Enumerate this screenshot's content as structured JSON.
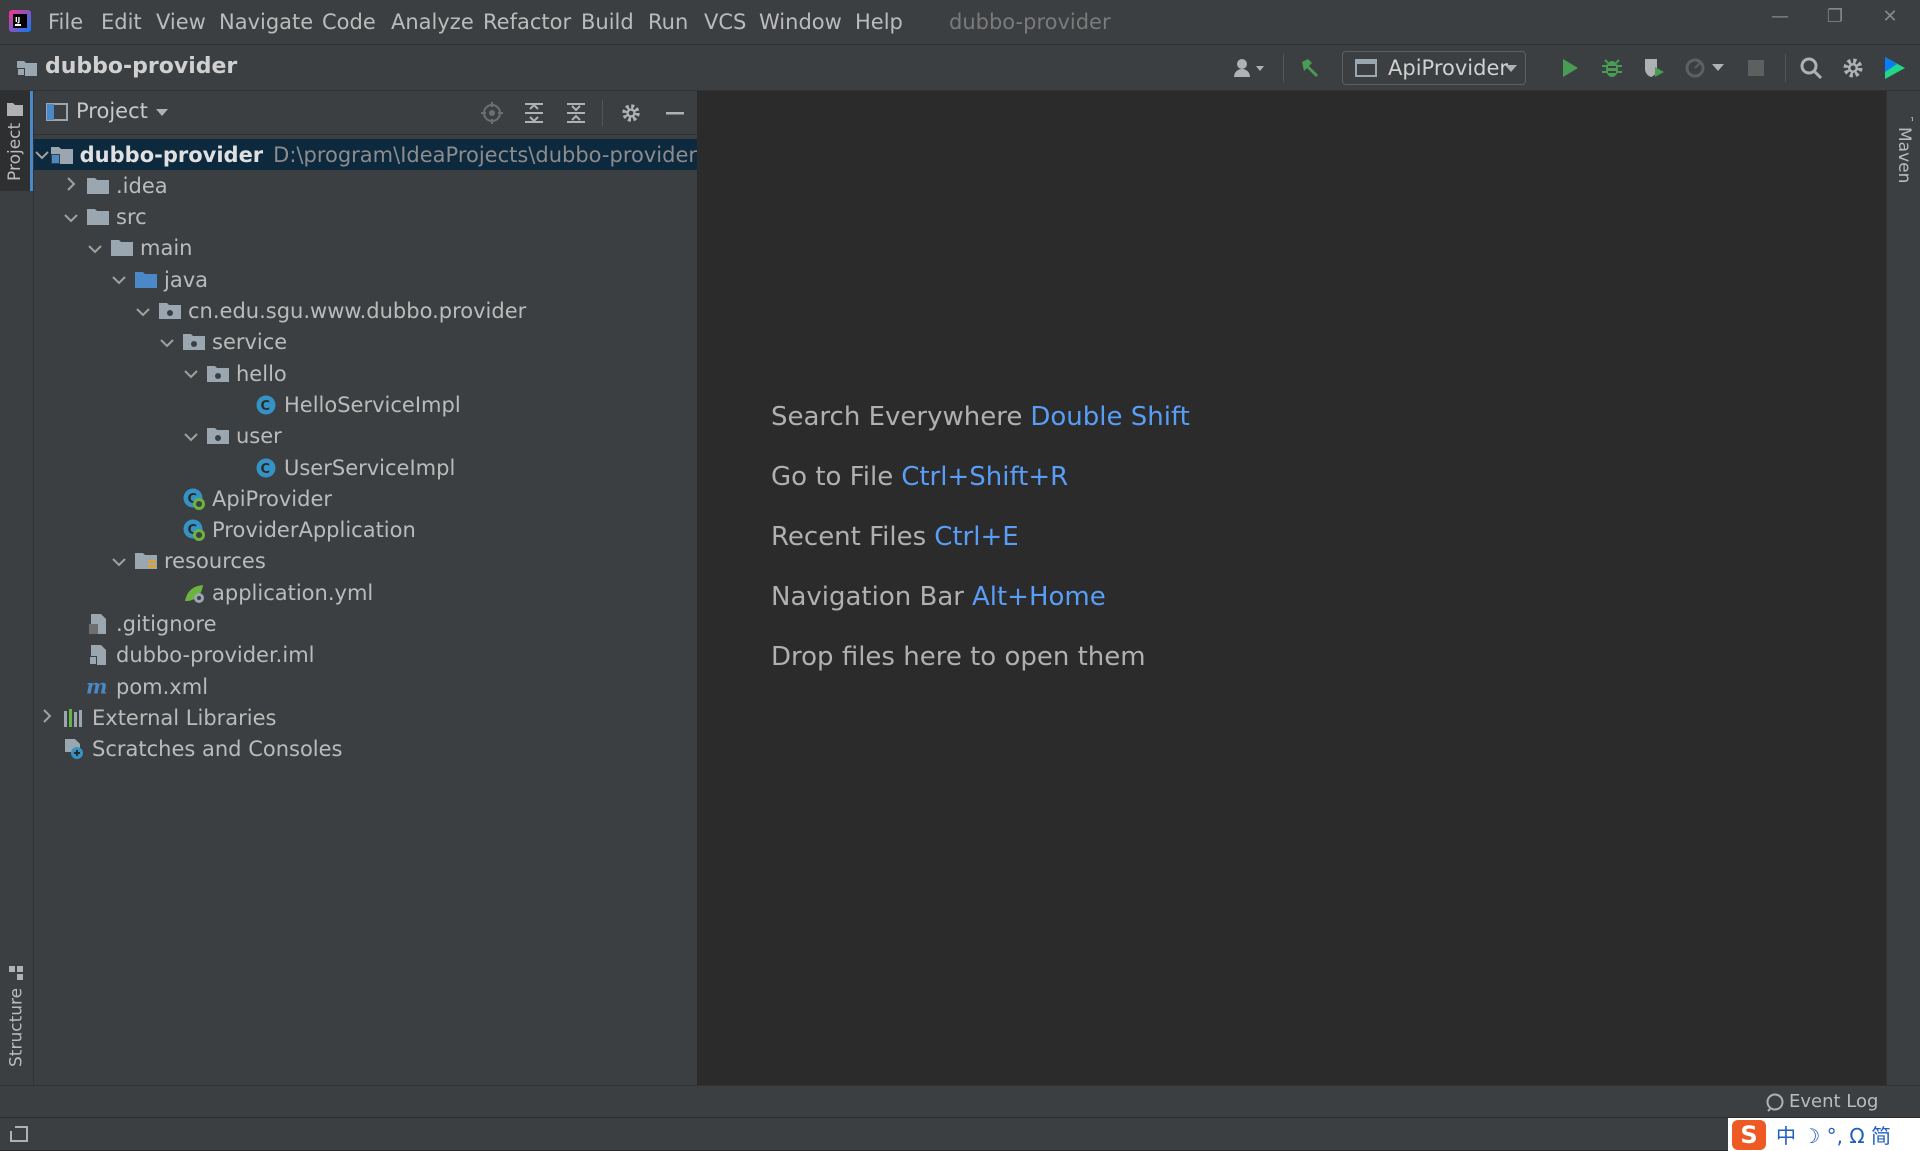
{
  "menu": {
    "items": [
      {
        "label": "File"
      },
      {
        "label": "Edit"
      },
      {
        "label": "View"
      },
      {
        "label": "Navigate"
      },
      {
        "label": "Code"
      },
      {
        "label": "Analyze"
      },
      {
        "label": "Refactor"
      },
      {
        "label": "Build"
      },
      {
        "label": "Run"
      },
      {
        "label": "VCS"
      },
      {
        "label": "Window"
      },
      {
        "label": "Help"
      }
    ],
    "window_title": "dubbo-provider"
  },
  "navbar": {
    "project_name": "dubbo-provider",
    "run_config": "ApiProvider"
  },
  "stripes": {
    "left_top": "Project",
    "left_bottom": "Structure",
    "right_top": "Maven"
  },
  "project_panel": {
    "title": "Project",
    "tree": [
      {
        "label": "dubbo-provider",
        "path": "D:\\program\\IdeaProjects\\dubbo-provider",
        "icon": "module-folder-icon",
        "chevron": "down"
      },
      {
        "label": ".idea",
        "icon": "folder-icon",
        "chevron": "right"
      },
      {
        "label": "src",
        "icon": "folder-icon",
        "chevron": "down"
      },
      {
        "label": "main",
        "icon": "folder-icon",
        "chevron": "down"
      },
      {
        "label": "java",
        "icon": "source-folder-icon",
        "chevron": "down"
      },
      {
        "label": "cn.edu.sgu.www.dubbo.provider",
        "icon": "package-icon",
        "chevron": "down"
      },
      {
        "label": "service",
        "icon": "package-icon",
        "chevron": "down"
      },
      {
        "label": "hello",
        "icon": "package-icon",
        "chevron": "down"
      },
      {
        "label": "HelloServiceImpl",
        "icon": "class-icon",
        "chevron": ""
      },
      {
        "label": "user",
        "icon": "package-icon",
        "chevron": "down"
      },
      {
        "label": "UserServiceImpl",
        "icon": "class-icon",
        "chevron": ""
      },
      {
        "label": "ApiProvider",
        "icon": "spring-class-icon",
        "chevron": ""
      },
      {
        "label": "ProviderApplication",
        "icon": "spring-class-icon",
        "chevron": ""
      },
      {
        "label": "resources",
        "icon": "resources-folder-icon",
        "chevron": "down"
      },
      {
        "label": "application.yml",
        "icon": "yaml-file-icon",
        "chevron": ""
      },
      {
        "label": ".gitignore",
        "icon": "text-file-icon",
        "chevron": ""
      },
      {
        "label": "dubbo-provider.iml",
        "icon": "iml-file-icon",
        "chevron": ""
      },
      {
        "label": "pom.xml",
        "icon": "maven-file-icon",
        "chevron": ""
      },
      {
        "label": "External Libraries",
        "icon": "libraries-icon",
        "chevron": "right"
      },
      {
        "label": "Scratches and Consoles",
        "icon": "scratches-icon",
        "chevron": ""
      }
    ]
  },
  "editor": {
    "hints": [
      {
        "text": "Search Everywhere",
        "key": "Double Shift"
      },
      {
        "text": "Go to File",
        "key": "Ctrl+Shift+R"
      },
      {
        "text": "Recent Files",
        "key": "Ctrl+E"
      },
      {
        "text": "Navigation Bar",
        "key": "Alt+Home"
      },
      {
        "text": "Drop files here to open them",
        "key": ""
      }
    ]
  },
  "bottom": {
    "event_log": "Event Log"
  },
  "ime": {
    "logo": "S",
    "glyphs": "中 ☽ °, Ω 简"
  },
  "colors": {
    "background": "#2b2b2b",
    "panel": "#3c3f41",
    "selection": "#0d293e",
    "shortcut": "#589df6"
  }
}
